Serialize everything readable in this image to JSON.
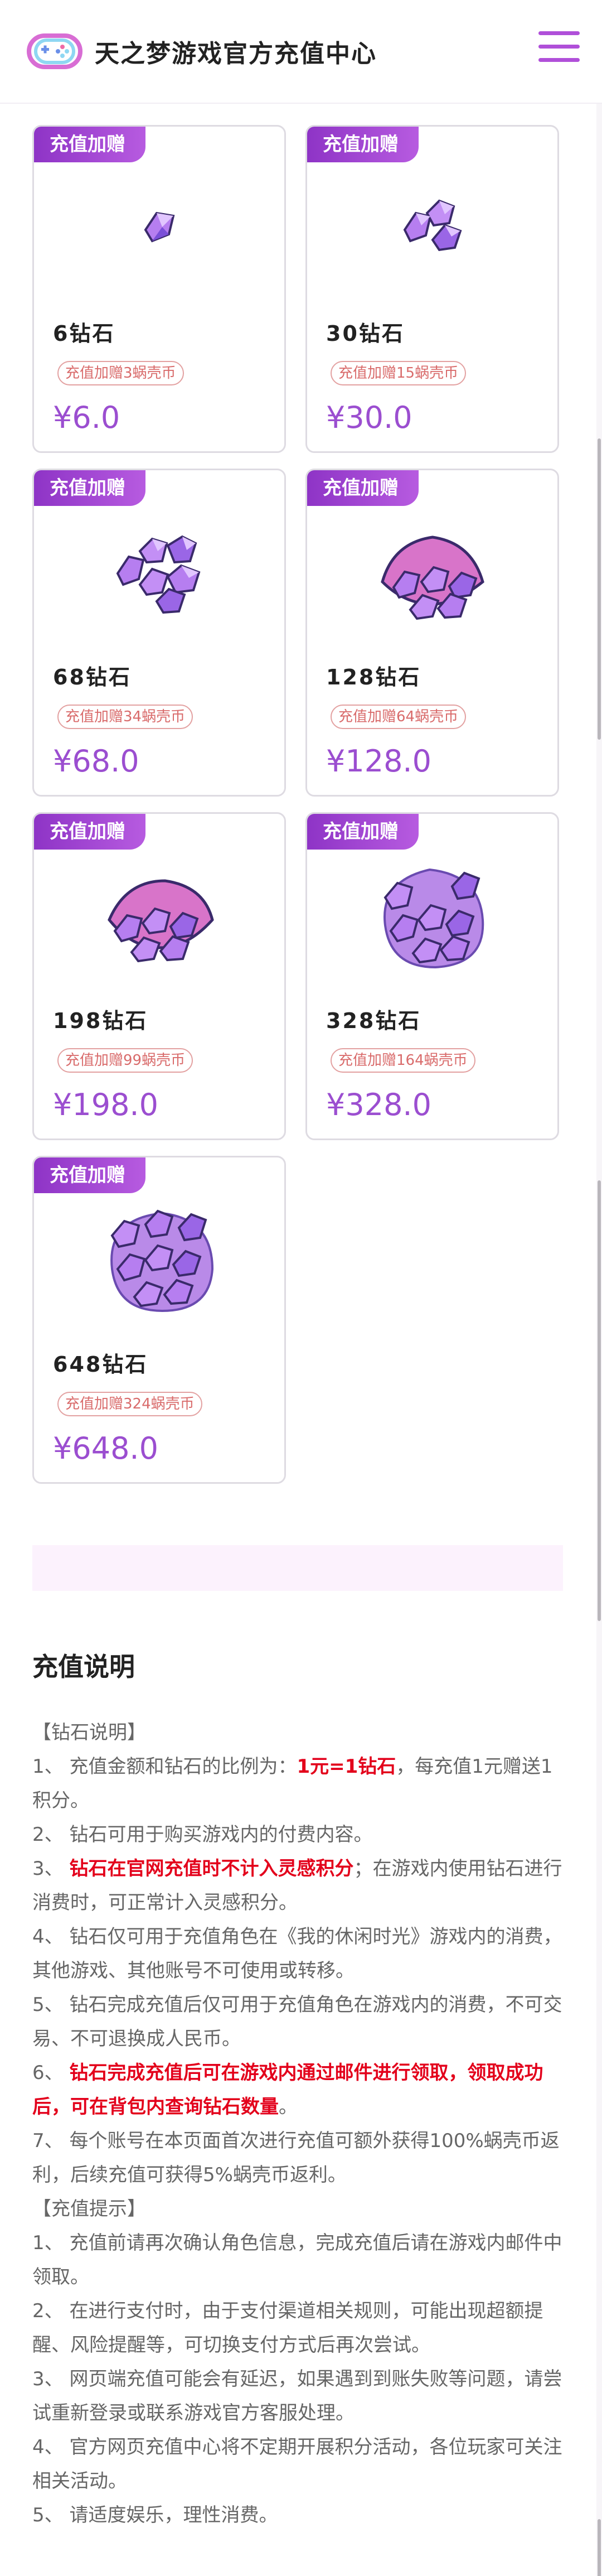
{
  "header": {
    "title": "天之梦游戏官方充值中心"
  },
  "icons": {
    "logo": "game-controller-logo-icon",
    "menu": "hamburger-menu-icon"
  },
  "colors": {
    "accent": "#9b4ed0",
    "badge": "#8e34c6",
    "warning": "#e3001b"
  },
  "products": [
    {
      "badge": "充值加赠",
      "name": "6钻石",
      "bonus": "充值加赠3蜗壳币",
      "price": "¥6.0"
    },
    {
      "badge": "充值加赠",
      "name": "30钻石",
      "bonus": "充值加赠15蜗壳币",
      "price": "¥30.0"
    },
    {
      "badge": "充值加赠",
      "name": "68钻石",
      "bonus": "充值加赠34蜗壳币",
      "price": "¥68.0"
    },
    {
      "badge": "充值加赠",
      "name": "128钻石",
      "bonus": "充值加赠64蜗壳币",
      "price": "¥128.0"
    },
    {
      "badge": "充值加赠",
      "name": "198钻石",
      "bonus": "充值加赠99蜗壳币",
      "price": "¥198.0"
    },
    {
      "badge": "充值加赠",
      "name": "328钻石",
      "bonus": "充值加赠164蜗壳币",
      "price": "¥328.0"
    },
    {
      "badge": "充值加赠",
      "name": "648钻石",
      "bonus": "充值加赠324蜗壳币",
      "price": "¥648.0"
    }
  ],
  "notes": {
    "title": "充值说明",
    "gem_header": "【钻石说明】",
    "n1_a": "1、 充值金额和钻石的比例为：",
    "n1_red": "1元=1钻石",
    "n1_b": "，每充值1元赠送1积分。",
    "n2": "2、 钻石可用于购买游戏内的付费内容。",
    "n3_a": "3、 ",
    "n3_red": "钻石在官网充值时不计入灵感积分",
    "n3_b": "；在游戏内使用钻石进行消费时，可正常计入灵感积分。",
    "n4": "4、 钻石仅可用于充值角色在《我的休闲时光》游戏内的消费，其他游戏、其他账号不可使用或转移。",
    "n5": "5、 钻石完成充值后仅可用于充值角色在游戏内的消费，不可交易、不可退换成人民币。",
    "n6_a": "6、 ",
    "n6_red": "钻石完成充值后可在游戏内通过邮件进行领取，领取成功后，可在背包内查询钻石数量",
    "n6_b": "。",
    "n7": "7、 每个账号在本页面首次进行充值可额外获得100%蜗壳币返利，后续充值可获得5%蜗壳币返利。",
    "tips_header": "【充值提示】",
    "t1": "1、 充值前请再次确认角色信息，完成充值后请在游戏内邮件中领取。",
    "t2": "2、 在进行支付时，由于支付渠道相关规则，可能出现超额提醒、风险提醒等，可切换支付方式后再次尝试。",
    "t3": "3、 网页端充值可能会有延迟，如果遇到到账失败等问题，请尝试重新登录或联系游戏官方客服处理。",
    "t4": "4、 官方网页充值中心将不定期开展积分活动，各位玩家可关注相关活动。",
    "t5": "5、 请适度娱乐，理性消费。"
  }
}
